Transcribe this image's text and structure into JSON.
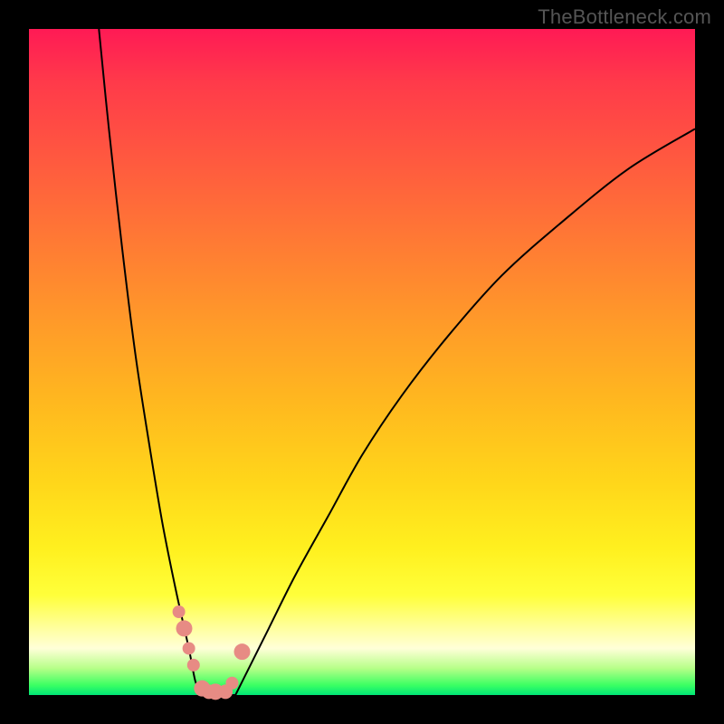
{
  "watermark": "TheBottleneck.com",
  "colors": {
    "frame": "#000000",
    "curve": "#000000",
    "marker_fill": "#e78b84",
    "marker_stroke": "#c96b64"
  },
  "chart_data": {
    "type": "line",
    "title": "",
    "xlabel": "",
    "ylabel": "",
    "xlim": [
      0,
      100
    ],
    "ylim": [
      0,
      100
    ],
    "note": "Values estimated from pixel positions; axes are unlabeled in the source image. y ≈ bottleneck %, minimum near x ≈ 25.",
    "series": [
      {
        "name": "left-branch",
        "x": [
          10.5,
          12,
          14,
          16,
          18,
          20,
          22,
          24,
          25,
          26
        ],
        "y": [
          100,
          85,
          67,
          51,
          38,
          26,
          16,
          7,
          2,
          0
        ]
      },
      {
        "name": "valley-floor",
        "x": [
          26,
          27,
          28,
          29,
          30,
          31
        ],
        "y": [
          0,
          0,
          0,
          0,
          0,
          0
        ]
      },
      {
        "name": "right-branch",
        "x": [
          31,
          33,
          36,
          40,
          45,
          50,
          56,
          63,
          71,
          80,
          90,
          100
        ],
        "y": [
          0,
          4,
          10,
          18,
          27,
          36,
          45,
          54,
          63,
          71,
          79,
          85
        ]
      }
    ],
    "markers": {
      "name": "highlighted-points",
      "x": [
        22.5,
        23.3,
        24.0,
        24.7,
        26.0,
        27.0,
        28.0,
        29.5,
        30.5,
        32.0
      ],
      "y": [
        12.5,
        10.0,
        7.0,
        4.5,
        1.0,
        0.5,
        0.5,
        0.5,
        1.8,
        6.5
      ],
      "r": [
        7,
        9,
        7,
        7,
        9,
        8,
        9,
        8,
        7,
        9
      ]
    }
  }
}
